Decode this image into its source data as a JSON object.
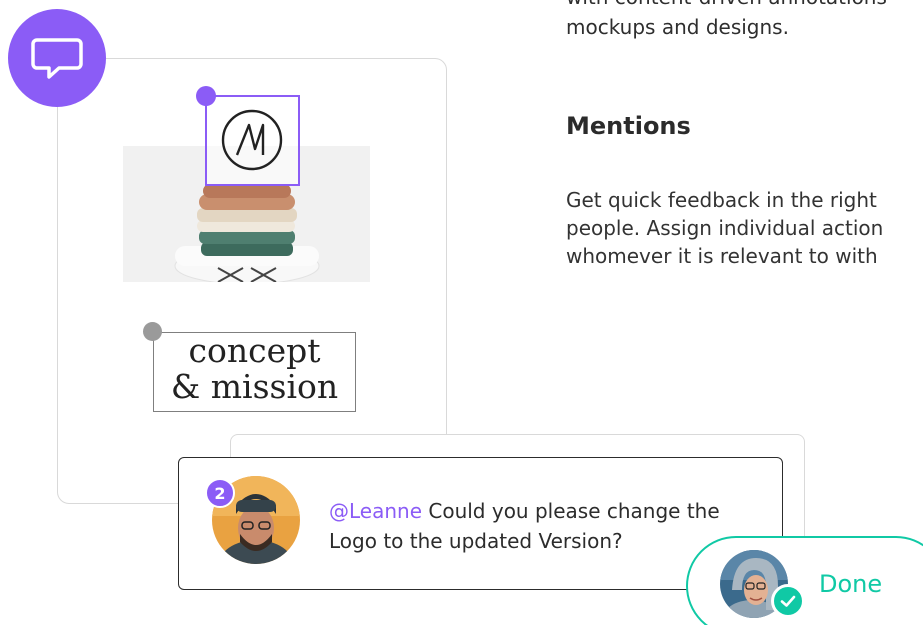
{
  "intro": {
    "line1": "with content-driven annotations",
    "line2": "mockups and designs."
  },
  "section": {
    "title": "Mentions",
    "para_line1": "Get quick feedback in the right",
    "para_line2": "people. Assign individual action",
    "para_line3": "whomever it is relevant to with"
  },
  "design": {
    "concept_line1": "concept",
    "concept_line2": "& mission"
  },
  "comment": {
    "badge": "2",
    "mention": "@Leanne",
    "text_rest": " Could you please change the",
    "text_line2": "Logo to the updated Version?"
  },
  "done": {
    "label": "Done"
  },
  "colors": {
    "accent": "#8b5cf6",
    "success": "#10c9a5"
  },
  "icons": [
    "chat-bubble-icon",
    "logo-m-icon",
    "check-icon"
  ]
}
